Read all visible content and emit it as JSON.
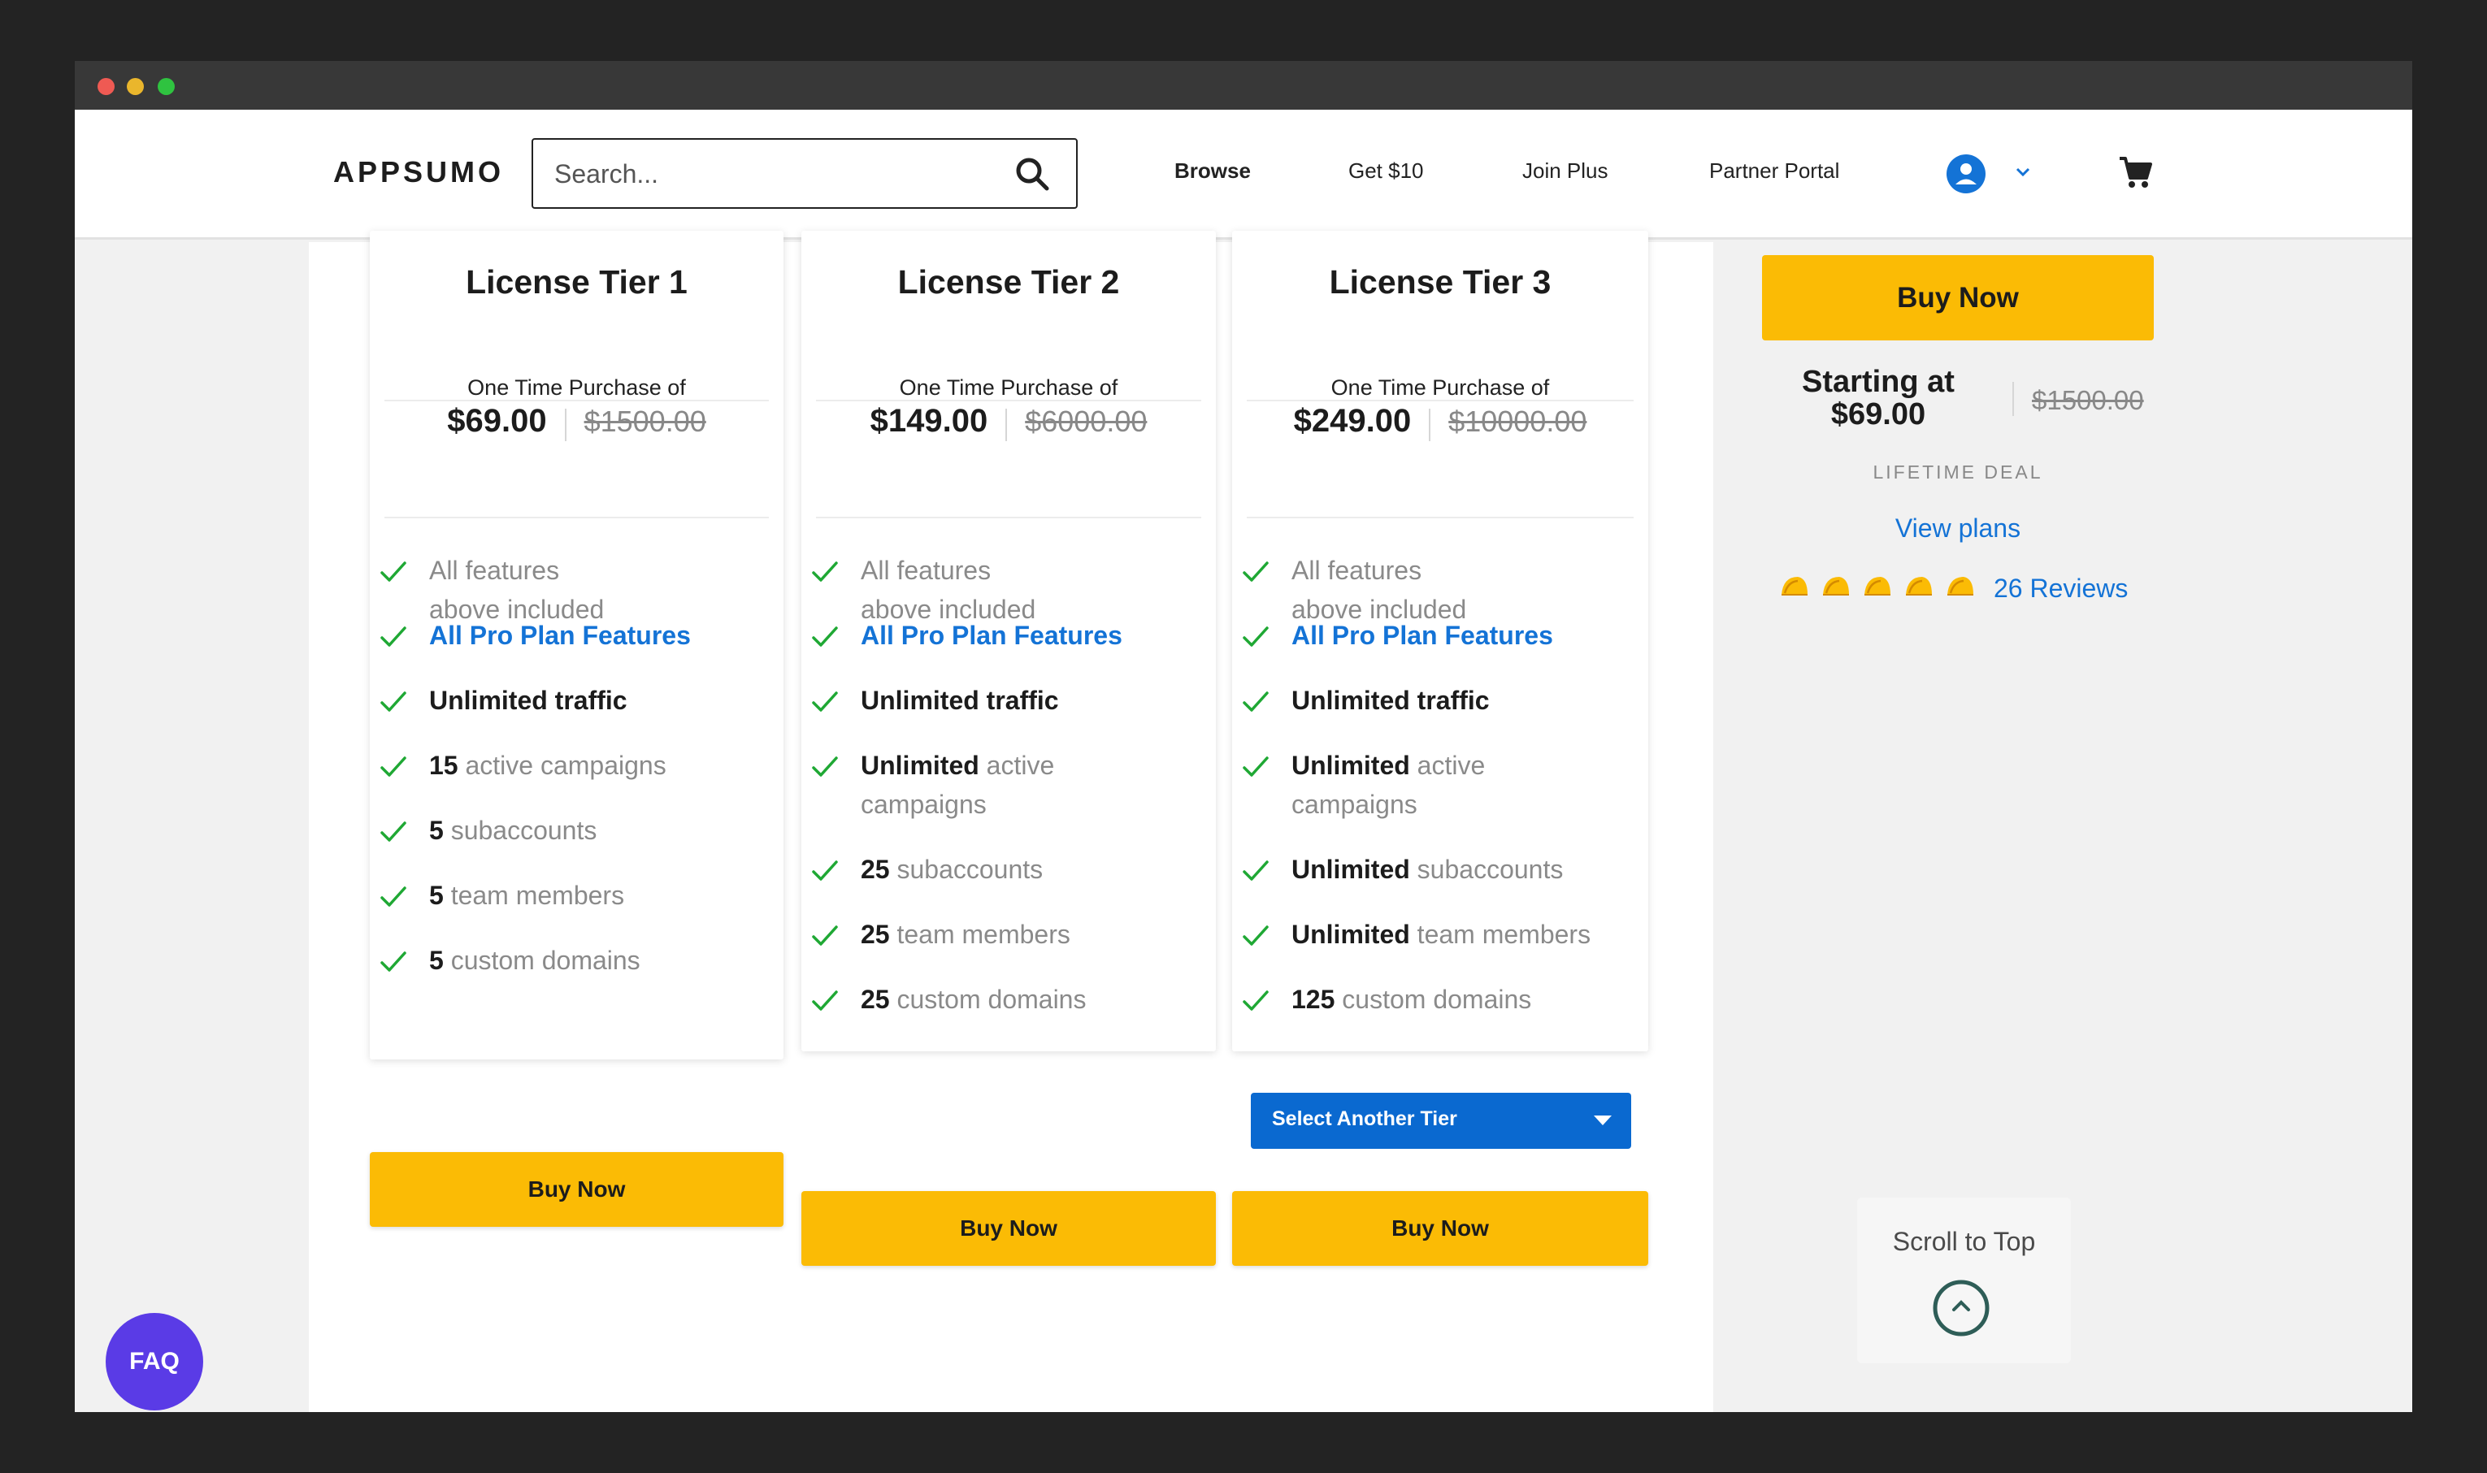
{
  "window": {
    "controls": [
      "close",
      "minimize",
      "maximize"
    ]
  },
  "header": {
    "logo": "APPSUMO",
    "search": {
      "placeholder": "Search...",
      "value": ""
    },
    "nav": [
      "Browse",
      "Get $10",
      "Join Plus",
      "Partner Portal"
    ]
  },
  "tiers": [
    {
      "title": "License Tier 1",
      "purchase_label": "One Time Purchase of",
      "price": "$69.00",
      "old_price": "$1500.00",
      "features": [
        {
          "bold": "",
          "text": "All features above included",
          "style": "muted"
        },
        {
          "bold": "",
          "text": "All Pro Plan Features",
          "style": "blue"
        },
        {
          "bold": "",
          "text": "Unlimited traffic",
          "style": "dark"
        },
        {
          "bold": "15",
          "text": " active campaigns",
          "style": "mixed"
        },
        {
          "bold": "5",
          "text": " subaccounts",
          "style": "mixed"
        },
        {
          "bold": "5",
          "text": " team members",
          "style": "mixed"
        },
        {
          "bold": "5",
          "text": " custom domains",
          "style": "mixed"
        }
      ],
      "buy_label": "Buy Now"
    },
    {
      "title": "License Tier 2",
      "purchase_label": "One Time Purchase of",
      "price": "$149.00",
      "old_price": "$6000.00",
      "features": [
        {
          "bold": "",
          "text": "All features above included",
          "style": "muted"
        },
        {
          "bold": "",
          "text": "All Pro Plan Features",
          "style": "blue"
        },
        {
          "bold": "",
          "text": "Unlimited traffic",
          "style": "dark"
        },
        {
          "bold": "Unlimited",
          "text": " active campaigns",
          "style": "mixed"
        },
        {
          "bold": "25",
          "text": " subaccounts",
          "style": "mixed"
        },
        {
          "bold": "25",
          "text": " team members",
          "style": "mixed"
        },
        {
          "bold": "25",
          "text": " custom domains",
          "style": "mixed"
        }
      ],
      "buy_label": "Buy Now"
    },
    {
      "title": "License Tier 3",
      "purchase_label": "One Time Purchase of",
      "price": "$249.00",
      "old_price": "$10000.00",
      "features": [
        {
          "bold": "",
          "text": "All features above included",
          "style": "muted"
        },
        {
          "bold": "",
          "text": "All Pro Plan Features",
          "style": "blue"
        },
        {
          "bold": "",
          "text": "Unlimited traffic",
          "style": "dark"
        },
        {
          "bold": "Unlimited",
          "text": " active campaigns",
          "style": "mixed"
        },
        {
          "bold": "Unlimited",
          "text": " subaccounts",
          "style": "mixed"
        },
        {
          "bold": "Unlimited",
          "text": " team members",
          "style": "mixed"
        },
        {
          "bold": "125",
          "text": " custom domains",
          "style": "mixed"
        }
      ],
      "select_label": "Select Another Tier",
      "buy_label": "Buy Now"
    }
  ],
  "sidebar": {
    "buy_label": "Buy Now",
    "starting_label": "Starting at",
    "starting_price": "$69.00",
    "old_price": "$1500.00",
    "deal_label": "LIFETIME DEAL",
    "view_plans": "View plans",
    "rating": 5,
    "reviews": "26 Reviews"
  },
  "scroll_top": {
    "label": "Scroll to Top"
  },
  "faq": {
    "label": "FAQ"
  },
  "colors": {
    "accent_yellow": "#fbbb05",
    "link_blue": "#1473d6",
    "select_blue": "#0a69d0",
    "check_green": "#1fa834",
    "faq_purple": "#5a3be6"
  }
}
